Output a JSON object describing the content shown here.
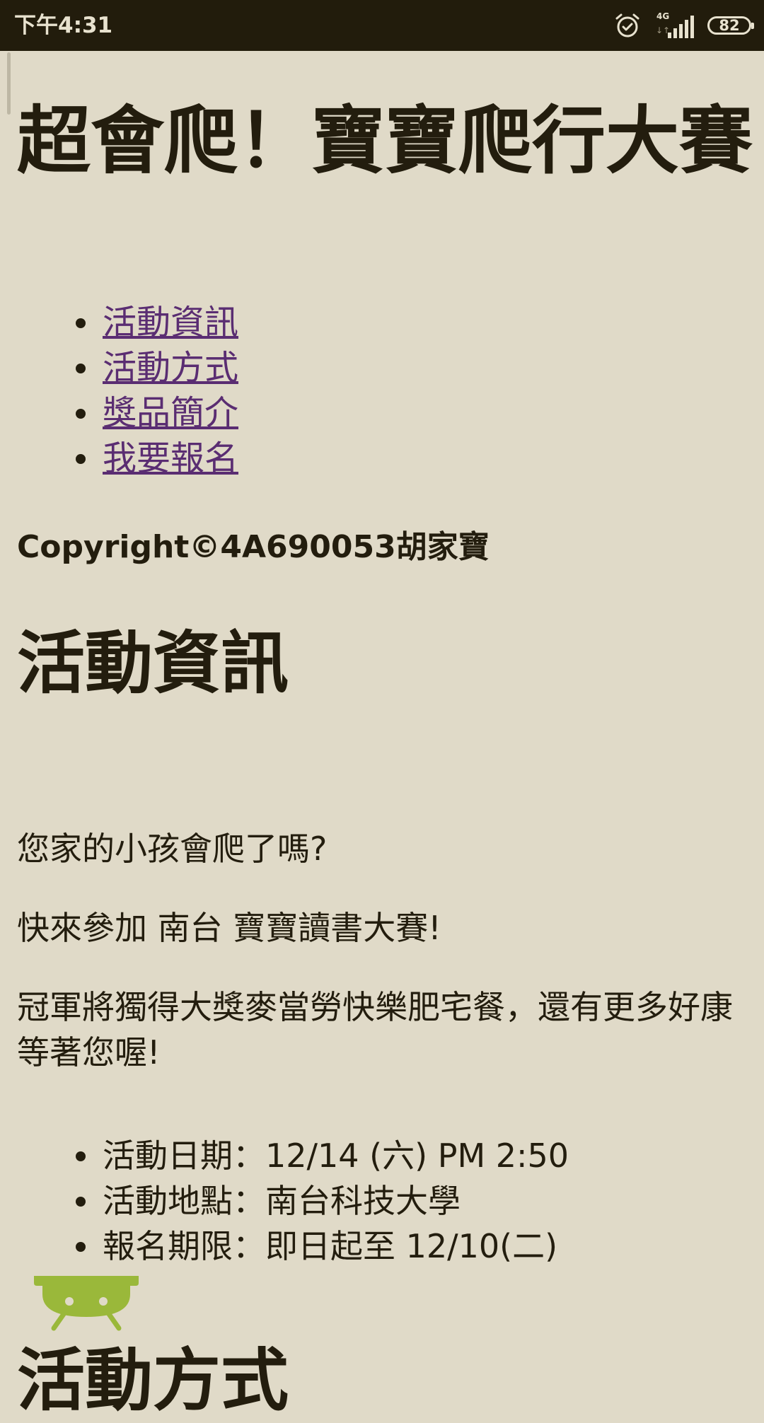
{
  "status_bar": {
    "time": "下午4:31",
    "network_type": "4G",
    "data_arrows": "↓↑",
    "battery": "82",
    "icons": [
      "alarm-icon",
      "signal-icon",
      "battery-icon"
    ]
  },
  "page": {
    "title": "超會爬！寶寶爬行大賽",
    "nav_links": [
      {
        "label": "活動資訊"
      },
      {
        "label": "活動方式"
      },
      {
        "label": "獎品簡介"
      },
      {
        "label": "我要報名"
      }
    ],
    "copyright": "Copyright©4A690053胡家寶",
    "section_title": "活動資訊",
    "paragraphs": [
      "您家的小孩會爬了嗎?",
      "快來參加 南台 寶寶讀書大賽!",
      "冠軍將獨得大獎麥當勞快樂肥宅餐，還有更多好康等著您喔!"
    ],
    "info_items": [
      "活動日期：12/14 (六) PM 2:50",
      "活動地點：南台科技大學",
      "報名期限：即日起至 12/10(二)"
    ],
    "next_heading_partial": "活動方式"
  },
  "colors": {
    "background": "#e0dac8",
    "status_bar": "#221c0c",
    "text": "#231d0e",
    "link": "#5a2d72",
    "android": "#9ab83a"
  }
}
